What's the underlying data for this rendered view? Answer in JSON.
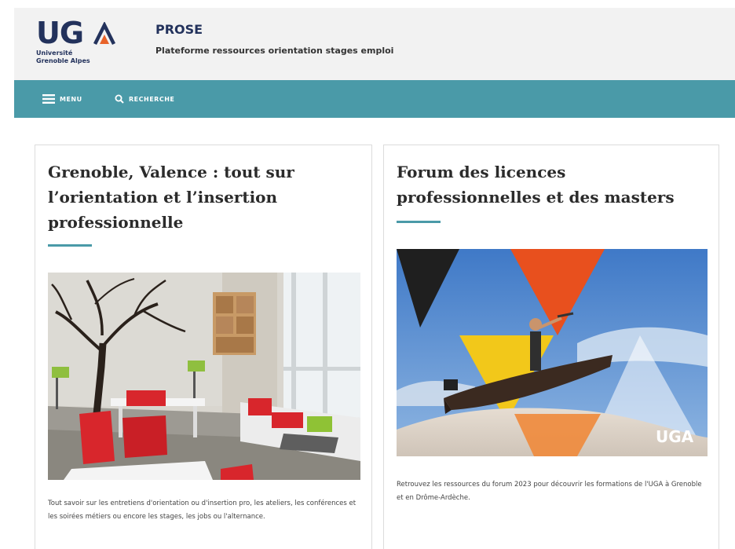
{
  "header": {
    "logo": {
      "letters": "UGA",
      "line1": "Université",
      "line2": "Grenoble Alpes"
    },
    "title": "PROSE",
    "subtitle": "Plateforme ressources orientation stages emploi"
  },
  "nav": {
    "menu_label": "MENU",
    "menu_icon": "hamburger-icon",
    "search_label": "RECHERCHE",
    "search_icon": "search-icon"
  },
  "cards": [
    {
      "title": "Grenoble, Valence : tout sur l’orientation et l’insertion professionnelle",
      "image": "lounge-room-photo",
      "text": "Tout savoir sur les entretiens d'orientation ou d'insertion pro, les ateliers, les conférences et les soirées métiers ou encore les stages, les jobs ou l'alternance."
    },
    {
      "title": "Forum des licences professionnelles et des masters",
      "image": "forum-poster-boat-illustration",
      "image_logo": "UGA",
      "text": "Retrouvez les ressources du forum 2023 pour découvrir les formations de l'UGA à Grenoble et en Drôme-Ardèche."
    }
  ],
  "colors": {
    "accent": "#4a9aa8",
    "logo_blue": "#23325c",
    "logo_orange": "#e8632a",
    "header_bg": "#f2f2f2"
  }
}
